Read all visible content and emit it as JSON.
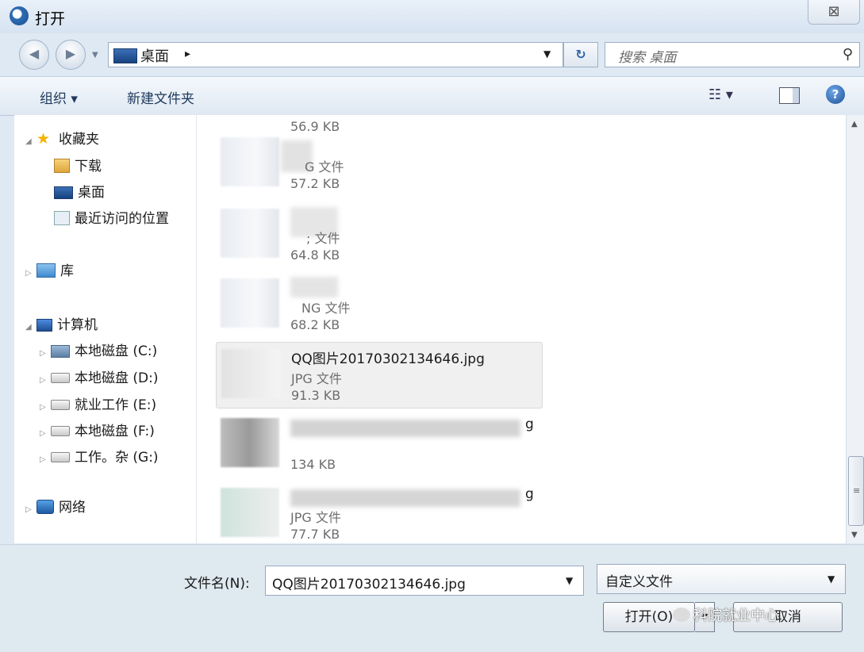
{
  "window": {
    "title": "打开",
    "close_glyph": "⊠"
  },
  "address_bar": {
    "location": "桌面",
    "sep": "▸",
    "refresh_glyph": "⁴↑",
    "search_placeholder": "搜索 桌面"
  },
  "toolbar": {
    "organize": "组织 ▾",
    "new_folder": "新建文件夹"
  },
  "nav": {
    "favorites": "收藏夹",
    "downloads": "下载",
    "desktop": "桌面",
    "recent": "最近访问的位置",
    "libraries": "库",
    "computer": "计算机",
    "drives": [
      "本地磁盘 (C:)",
      "本地磁盘 (D:)",
      "就业工作 (E:)",
      "本地磁盘 (F:)",
      "工作。杂 (G:)"
    ],
    "network": "网络"
  },
  "files": [
    {
      "name": "",
      "type": "",
      "size": "56.9 KB"
    },
    {
      "name": "",
      "type": "G 文件",
      "size": "57.2 KB"
    },
    {
      "name": "",
      "type": "; 文件",
      "size": "64.8 KB"
    },
    {
      "name": "",
      "type": "NG 文件",
      "size": "68.2 KB"
    },
    {
      "name": "QQ图片20170302134646.jpg",
      "type": "JPG 文件",
      "size": "91.3 KB"
    },
    {
      "name": "g",
      "type": "",
      "size": "134 KB"
    },
    {
      "name": "g",
      "type": "JPG 文件",
      "size": "77.7 KB"
    }
  ],
  "bottom": {
    "filename_label": "文件名(N):",
    "filename_value": "QQ图片20170302134646.jpg",
    "filetype_value": "自定义文件",
    "open_label": "打开(O)",
    "cancel_label": "取消"
  },
  "watermark": "科院就业中心"
}
